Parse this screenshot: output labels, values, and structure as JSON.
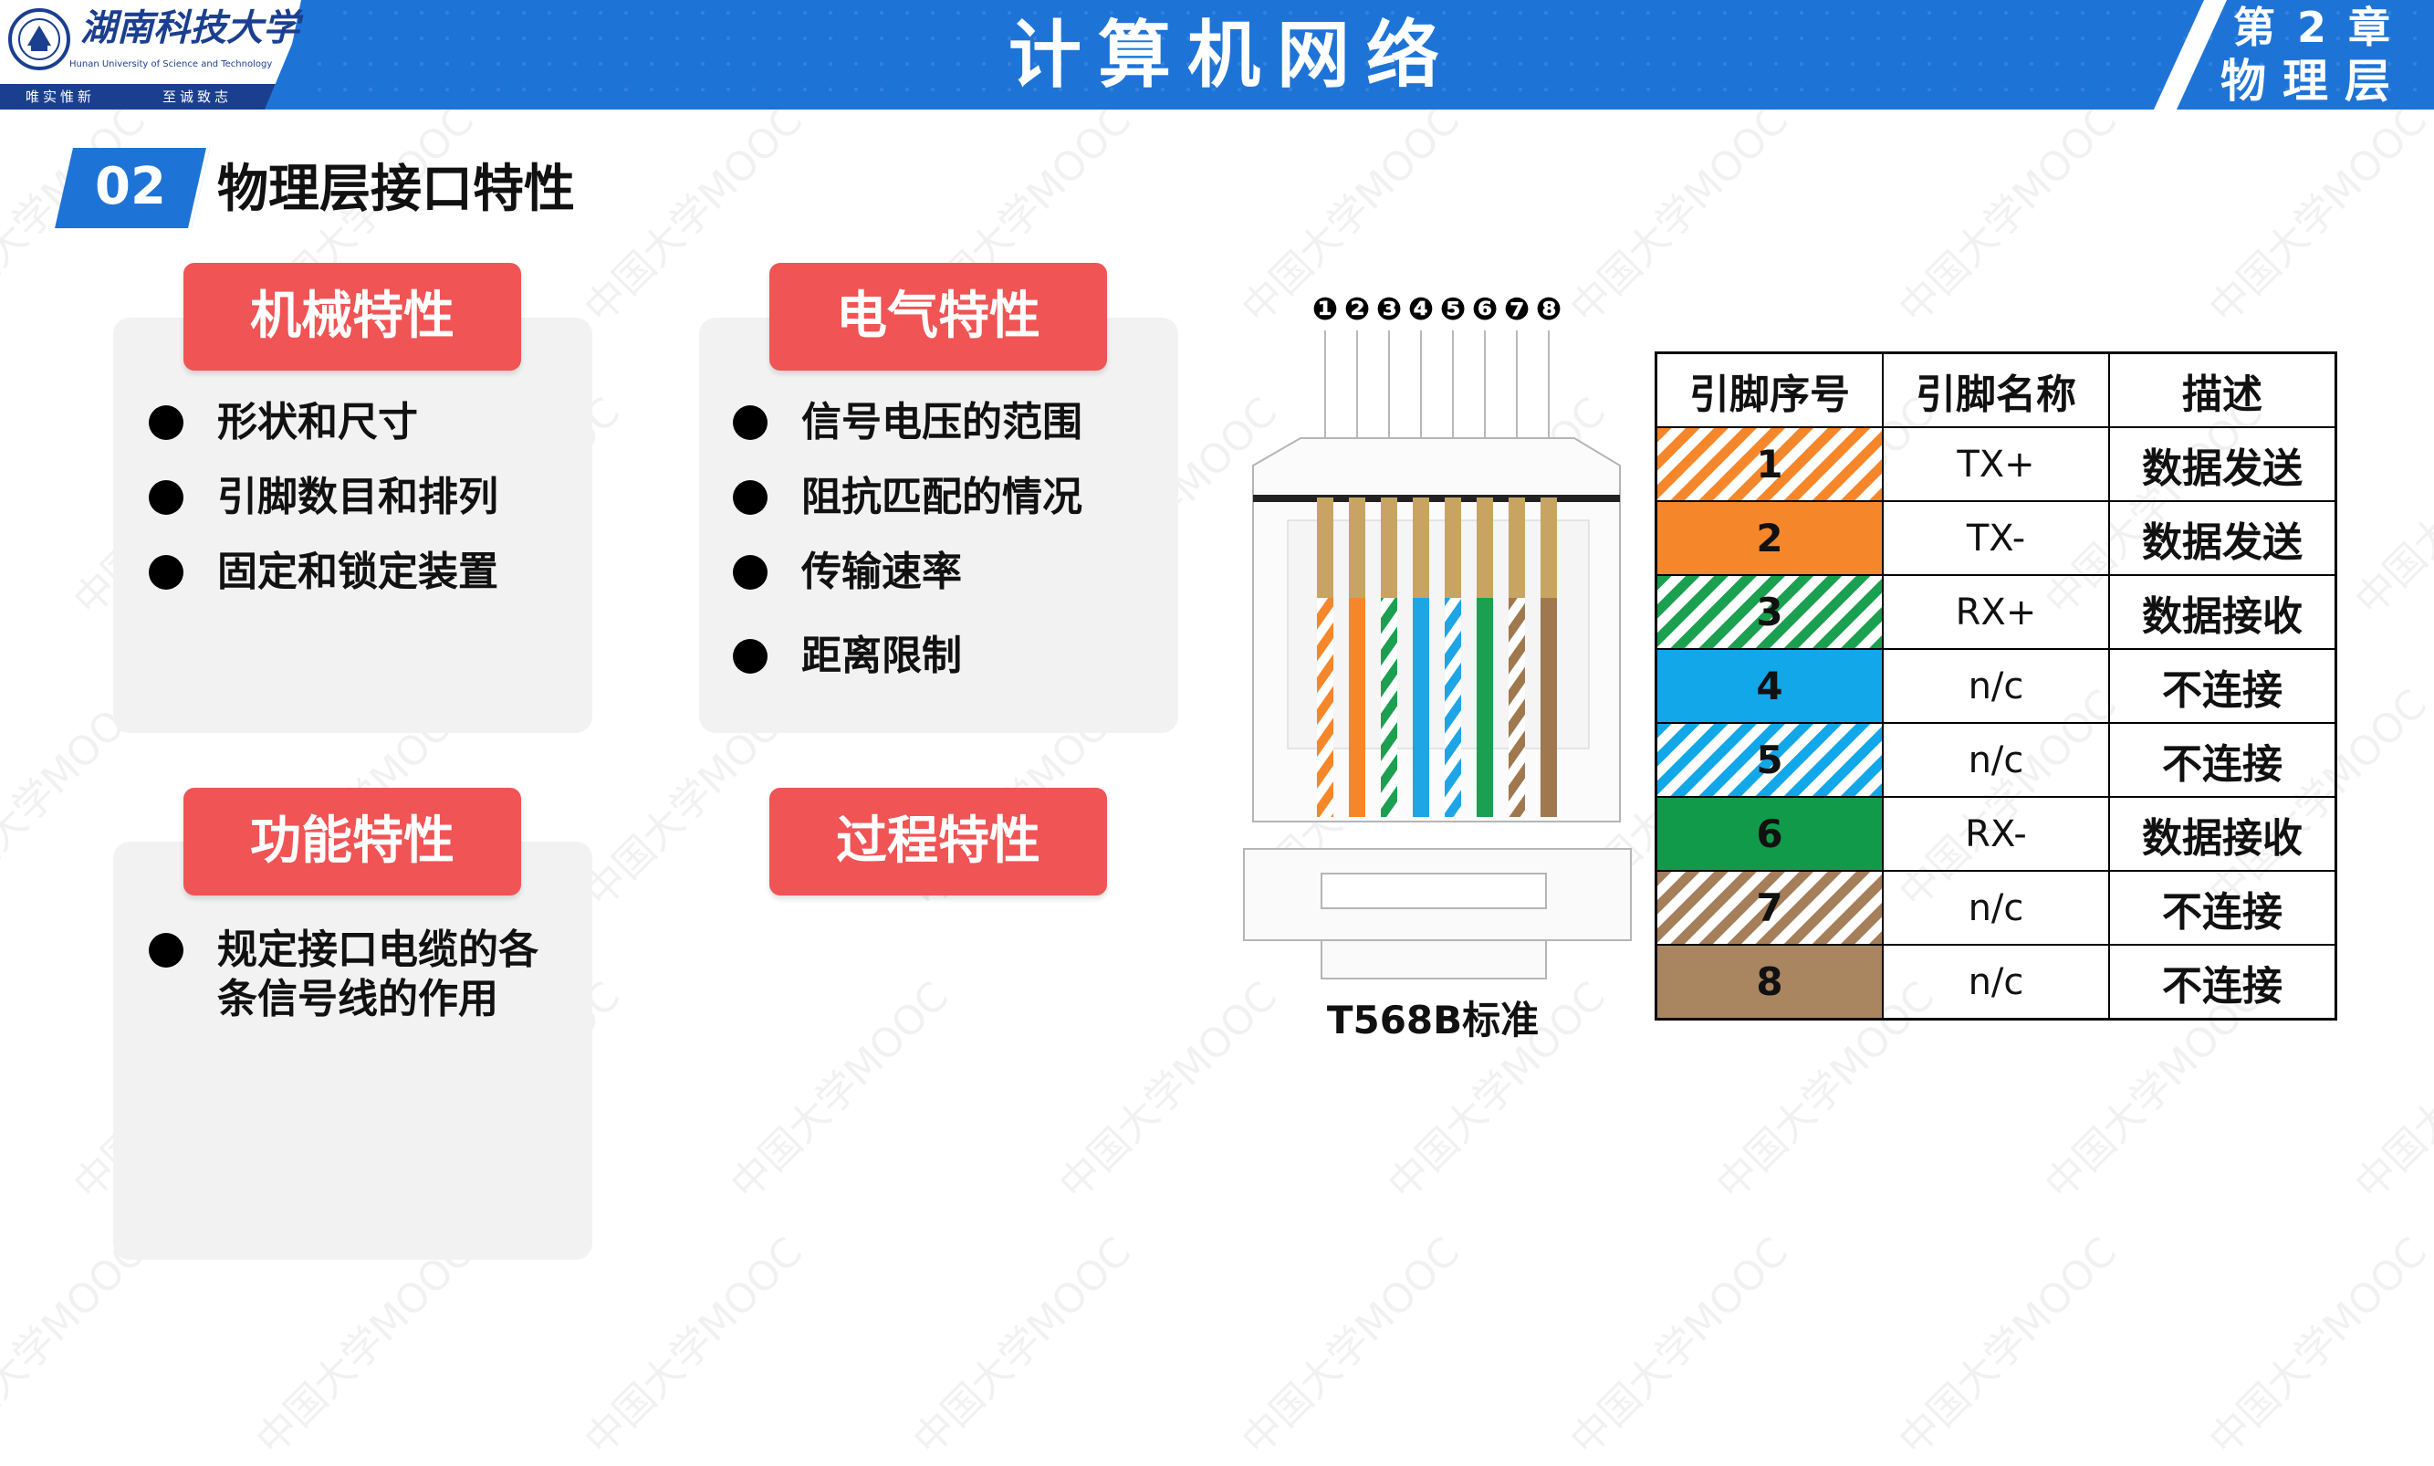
{
  "header": {
    "title": "计算机网络",
    "chapter_line1": "第 2 章",
    "chapter_line2": "物理层",
    "logo_name": "湖南科技大学",
    "logo_en": "Hunan University of Science and Technology",
    "logo_motto_left": "唯实惟新",
    "logo_motto_right": "至诚致志"
  },
  "section": {
    "number": "02",
    "title": "物理层接口特性"
  },
  "panels": {
    "mechanical": {
      "title": "机械特性",
      "items": [
        "形状和尺寸",
        "引脚数目和排列",
        "固定和锁定装置"
      ]
    },
    "electrical": {
      "title": "电气特性",
      "items": [
        "信号电压的范围",
        "阻抗匹配的情况",
        "传输速率",
        "距离限制"
      ]
    },
    "functional": {
      "title": "功能特性",
      "items": [
        "规定接口电缆的各",
        "条信号线的作用"
      ]
    },
    "procedural": {
      "title": "过程特性"
    }
  },
  "connector": {
    "pin_labels": [
      "❶",
      "❷",
      "❸",
      "❹",
      "❺",
      "❻",
      "❼",
      "❽"
    ],
    "standard_label": "T568B标准",
    "wire_colors": [
      "#f5872a",
      "#f5872a",
      "#1aa050",
      "#1ea5e5",
      "#1ea5e5",
      "#1aa050",
      "#a07850",
      "#a07850"
    ],
    "wire_striped": [
      true,
      false,
      true,
      false,
      true,
      false,
      true,
      false
    ]
  },
  "pin_table": {
    "headers": [
      "引脚序号",
      "引脚名称",
      "描述"
    ],
    "rows": [
      {
        "num": "1",
        "name": "TX+",
        "desc": "数据发送",
        "color": "#f5872a",
        "striped": true
      },
      {
        "num": "2",
        "name": "TX-",
        "desc": "数据发送",
        "color": "#f5872a",
        "striped": false
      },
      {
        "num": "3",
        "name": "RX+",
        "desc": "数据接收",
        "color": "#1aa050",
        "striped": true
      },
      {
        "num": "4",
        "name": "n/c",
        "desc": "不连接",
        "color": "#12a7e8",
        "striped": false
      },
      {
        "num": "5",
        "name": "n/c",
        "desc": "不连接",
        "color": "#12a7e8",
        "striped": true
      },
      {
        "num": "6",
        "name": "RX-",
        "desc": "数据接收",
        "color": "#129a4b",
        "striped": false
      },
      {
        "num": "7",
        "name": "n/c",
        "desc": "不连接",
        "color": "#a57e5a",
        "striped": true
      },
      {
        "num": "8",
        "name": "n/c",
        "desc": "不连接",
        "color": "#a98560",
        "striped": false
      }
    ]
  },
  "watermark": "中国大学MOOC",
  "colors": {
    "header_blue": "#1e74d6",
    "pill_red": "#f05454",
    "panel_gray": "#f2f2f2"
  }
}
